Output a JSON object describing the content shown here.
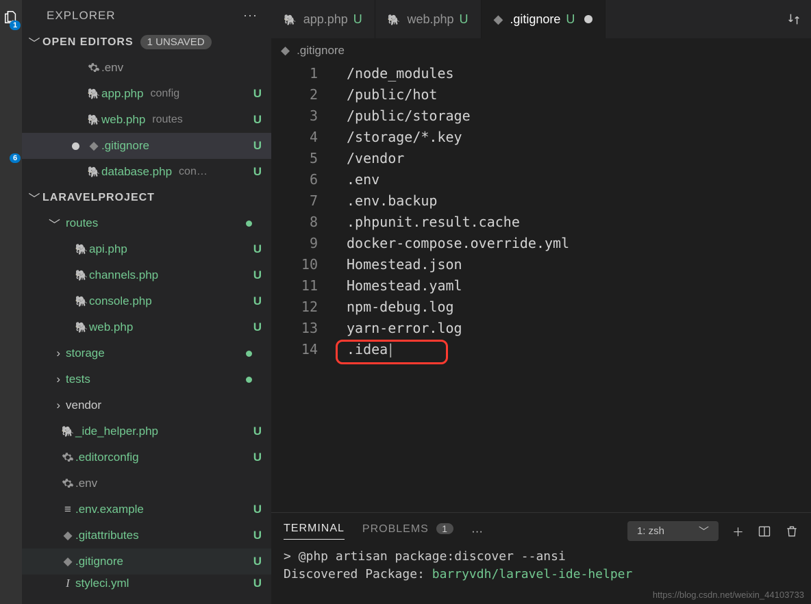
{
  "sidebar": {
    "title": "EXPLORER",
    "sections": {
      "open_editors": {
        "title": "OPEN EDITORS",
        "unsaved_label": "1 UNSAVED",
        "items": [
          {
            "icon": "gear",
            "name": ".env",
            "detail": "",
            "status": "",
            "nameClass": "fname-dim"
          },
          {
            "icon": "php",
            "name": "app.php",
            "detail": "config",
            "status": "U",
            "nameClass": "fname-green"
          },
          {
            "icon": "php",
            "name": "web.php",
            "detail": "routes",
            "status": "U",
            "nameClass": "fname-green"
          },
          {
            "icon": "diamond",
            "name": ".gitignore",
            "detail": "",
            "status": "U",
            "nameClass": "fname-green",
            "active": true,
            "dirty": true
          },
          {
            "icon": "php",
            "name": "database.php",
            "detail": "con…",
            "status": "U",
            "nameClass": "fname-green"
          }
        ]
      },
      "project": {
        "title": "LARAVELPROJECT",
        "items": [
          {
            "type": "folder",
            "chev": "down",
            "name": "routes",
            "dot": true,
            "nameClass": "fname-green"
          },
          {
            "type": "file",
            "icon": "php",
            "name": "api.php",
            "status": "U",
            "nameClass": "fname-green",
            "indent": 2
          },
          {
            "type": "file",
            "icon": "php",
            "name": "channels.php",
            "status": "U",
            "nameClass": "fname-green",
            "indent": 2
          },
          {
            "type": "file",
            "icon": "php",
            "name": "console.php",
            "status": "U",
            "nameClass": "fname-green",
            "indent": 2
          },
          {
            "type": "file",
            "icon": "php",
            "name": "web.php",
            "status": "U",
            "nameClass": "fname-green",
            "indent": 2
          },
          {
            "type": "folder",
            "chev": "right",
            "name": "storage",
            "dot": true,
            "nameClass": "fname-green"
          },
          {
            "type": "folder",
            "chev": "right",
            "name": "tests",
            "dot": true,
            "nameClass": "fname-green"
          },
          {
            "type": "folder",
            "chev": "right",
            "name": "vendor",
            "nameClass": "fname-norm"
          },
          {
            "type": "file",
            "icon": "php",
            "name": "_ide_helper.php",
            "status": "U",
            "nameClass": "fname-green"
          },
          {
            "type": "file",
            "icon": "gear",
            "name": ".editorconfig",
            "status": "U",
            "nameClass": "fname-green"
          },
          {
            "type": "file",
            "icon": "gear",
            "name": ".env",
            "nameClass": "fname-dim"
          },
          {
            "type": "file",
            "icon": "lines",
            "name": ".env.example",
            "status": "U",
            "nameClass": "fname-green"
          },
          {
            "type": "file",
            "icon": "diamond",
            "name": ".gitattributes",
            "status": "U",
            "nameClass": "fname-green"
          },
          {
            "type": "file",
            "icon": "diamond",
            "name": ".gitignore",
            "status": "U",
            "nameClass": "fname-green",
            "sel": true
          },
          {
            "type": "file",
            "icon": "italic",
            "name": "styleci.yml",
            "status": "U",
            "nameClass": "fname-green",
            "partial": true
          }
        ]
      }
    }
  },
  "activitybar": {
    "badge_top": "1",
    "badge_scm": "6"
  },
  "tabs": [
    {
      "icon": "php",
      "name": "app.php",
      "mod": "U"
    },
    {
      "icon": "php",
      "name": "web.php",
      "mod": "U"
    },
    {
      "icon": "diamond",
      "name": ".gitignore",
      "mod": "U",
      "active": true,
      "dirty": true
    }
  ],
  "breadcrumb": {
    "icon": "diamond",
    "name": ".gitignore"
  },
  "code_lines": [
    "/node_modules",
    "/public/hot",
    "/public/storage",
    "/storage/*.key",
    "/vendor",
    ".env",
    ".env.backup",
    ".phpunit.result.cache",
    "docker-compose.override.yml",
    "Homestead.json",
    "Homestead.yaml",
    "npm-debug.log",
    "yarn-error.log",
    ".idea"
  ],
  "panel": {
    "tabs": {
      "terminal": "TERMINAL",
      "problems": "PROBLEMS",
      "problems_count": "1"
    },
    "terminal_select": "1: zsh",
    "lines": [
      {
        "text": "> @php artisan package:discover --ansi"
      },
      {
        "prefix": "Discovered Package: ",
        "pkg": "barryvdh/laravel-ide-helper"
      }
    ]
  },
  "watermark": "https://blog.csdn.net/weixin_44103733"
}
